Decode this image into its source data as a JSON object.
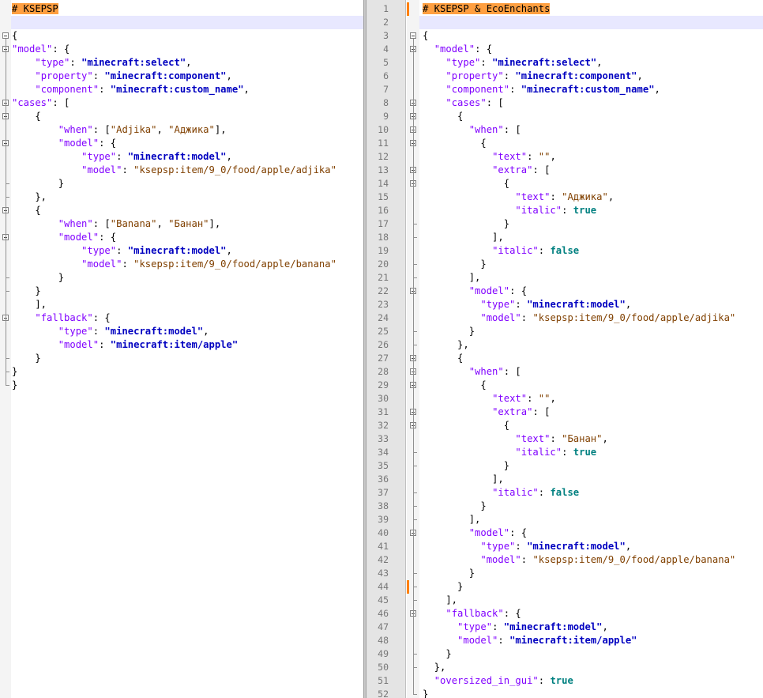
{
  "left": {
    "lines": [
      "# KSEPSP",
      "",
      "{",
      "\"model\": {",
      "    \"type\": \"minecraft:select\",",
      "    \"property\": \"minecraft:component\",",
      "    \"component\": \"minecraft:custom_name\",",
      "\"cases\": [",
      "    {",
      "        \"when\": [\"Adjika\", \"Аджика\"],",
      "        \"model\": {",
      "            \"type\": \"minecraft:model\",",
      "            \"model\": \"ksepsp:item/9_0/food/apple/adjika\"",
      "        }",
      "    },",
      "    {",
      "        \"when\": [\"Banana\", \"Банан\"],",
      "        \"model\": {",
      "            \"type\": \"minecraft:model\",",
      "            \"model\": \"ksepsp:item/9_0/food/apple/banana\"",
      "        }",
      "    }",
      "    ],",
      "    \"fallback\": {",
      "        \"type\": \"minecraft:model\",",
      "        \"model\": \"minecraft:item/apple\"",
      "    }",
      "}",
      "}"
    ]
  },
  "right": {
    "lines": [
      "# KSEPSP & EcoEnchants",
      "",
      "{",
      "  \"model\": {",
      "    \"type\": \"minecraft:select\",",
      "    \"property\": \"minecraft:component\",",
      "    \"component\": \"minecraft:custom_name\",",
      "    \"cases\": [",
      "      {",
      "        \"when\": [",
      "          {",
      "            \"text\": \"\",",
      "            \"extra\": [",
      "              {",
      "                \"text\": \"Аджика\",",
      "                \"italic\": true",
      "              }",
      "            ],",
      "            \"italic\": false",
      "          }",
      "        ],",
      "        \"model\": {",
      "          \"type\": \"minecraft:model\",",
      "          \"model\": \"ksepsp:item/9_0/food/apple/adjika\"",
      "        }",
      "      },",
      "      {",
      "        \"when\": [",
      "          {",
      "            \"text\": \"\",",
      "            \"extra\": [",
      "              {",
      "                \"text\": \"Банан\",",
      "                \"italic\": true",
      "              }",
      "            ],",
      "            \"italic\": false",
      "          }",
      "        ],",
      "        \"model\": {",
      "          \"type\": \"minecraft:model\",",
      "          \"model\": \"ksepsp:item/9_0/food/apple/banana\"",
      "        }",
      "      }",
      "    ],",
      "    \"fallback\": {",
      "      \"type\": \"minecraft:model\",",
      "      \"model\": \"minecraft:item/apple\"",
      "    }",
      "  },",
      "  \"oversized_in_gui\": true",
      "}"
    ],
    "line_numbers": [
      "1",
      "2",
      "3",
      "4",
      "5",
      "6",
      "7",
      "8",
      "9",
      "10",
      "11",
      "12",
      "13",
      "14",
      "15",
      "16",
      "17",
      "18",
      "19",
      "20",
      "21",
      "22",
      "23",
      "24",
      "25",
      "26",
      "27",
      "28",
      "29",
      "30",
      "31",
      "32",
      "33",
      "34",
      "35",
      "36",
      "37",
      "38",
      "39",
      "40",
      "41",
      "42",
      "43",
      "44",
      "45",
      "46",
      "47",
      "48",
      "49",
      "50",
      "51",
      "52"
    ]
  },
  "colors": {
    "key": "#8000ff",
    "string_value": "#0000c0",
    "boolean": "#008080",
    "header_highlight": "#ff9f40",
    "change_marker": "#ff8000"
  }
}
